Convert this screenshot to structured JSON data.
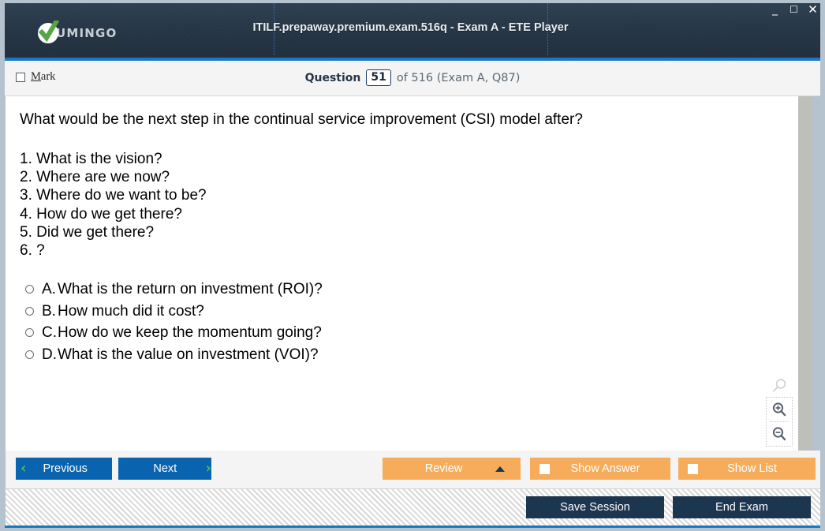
{
  "window": {
    "brand": "UMINGO",
    "title": "ITILF.prepaway.premium.exam.516q - Exam A - ETE Player",
    "controls": {
      "minimize": "_",
      "maximize": "☐",
      "close": "✕"
    },
    "colors": {
      "header_bg": "#253545",
      "accent_blue": "#1779c4",
      "nav_button": "#0a63ae",
      "orange_button": "#f7ac5b",
      "dark_button": "#1d3650",
      "check_green": "#55a544",
      "chevron_green": "#5cb949",
      "frame": "#b4c3cd"
    }
  },
  "question_strip": {
    "mark_label_accel": "M",
    "mark_label_rest": "ark",
    "counter_label": "Question",
    "current": "51",
    "rest": "of 516 (Exam A, Q87)"
  },
  "question": {
    "stem": "What would be the next step in the continual service improvement (CSI) model after?",
    "steps": [
      "1. What is the vision?",
      "2. Where are we now?",
      "3. Where do we want to be?",
      "4. How do we get there?",
      "5. Did we get there?",
      "6. ?"
    ],
    "choices": [
      {
        "letter": "A.",
        "text": "What is the return on investment (ROI)?"
      },
      {
        "letter": "B.",
        "text": "How much did it cost?"
      },
      {
        "letter": "C.",
        "text": "How do we keep the momentum going?"
      },
      {
        "letter": "D.",
        "text": "What is the value on investment (VOI)?"
      }
    ]
  },
  "toolbar": {
    "previous_label": "Previous",
    "next_label": "Next",
    "previous_chevron": "‹",
    "next_chevron": "›",
    "review_label": "Review",
    "show_answer_label": "Show Answer",
    "show_list_label": "Show List",
    "save_session_label": "Save Session",
    "end_exam_label": "End Exam"
  }
}
